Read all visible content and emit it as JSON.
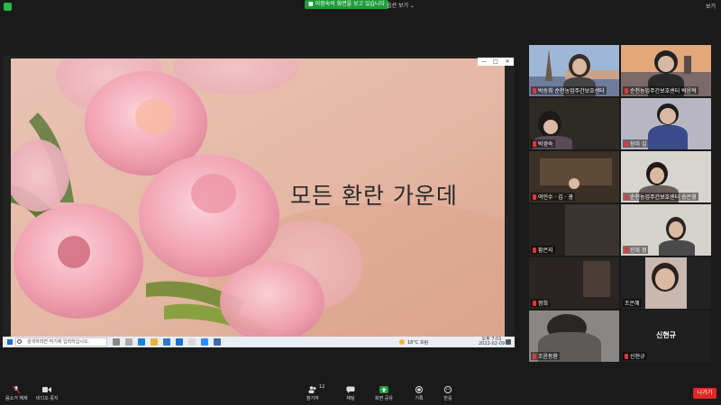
{
  "top_bar": {
    "share_banner": "■ 이정숙의 화면을 보고 있습니다",
    "view_options": "옵션 보기 ⌄",
    "view_label": "보기"
  },
  "shared_screen": {
    "slide_caption": "모든 환란 가운데",
    "window_controls": [
      "—",
      "□",
      "✕"
    ],
    "taskbar": {
      "search_placeholder": "검색하려면 여기에 입력하십시오.",
      "weather": "18°C 흐림",
      "time": "오후 7:01",
      "date": "2022-02-09"
    }
  },
  "gallery": {
    "tiles": [
      {
        "name": "박승희 순천농업주간보호센터",
        "muted": true
      },
      {
        "name": "순천농업주간보호센터 박윤혁",
        "muted": true
      },
      {
        "name": "박경숙",
        "muted": true
      },
      {
        "name": "장미 김",
        "muted": true
      },
      {
        "name": "여민수 · 김 · 광",
        "muted": true
      },
      {
        "name": "순천농업주간보호센터 송은영",
        "muted": true
      },
      {
        "name": "황은지",
        "muted": true
      },
      {
        "name": "진희 정",
        "muted": true
      },
      {
        "name": "정희",
        "muted": true
      },
      {
        "name": "조은혜",
        "muted": false
      },
      {
        "name": "조윤동환",
        "muted": true
      },
      {
        "name": "신현규",
        "muted": true,
        "display_name": "신현규"
      }
    ]
  },
  "toolbar": {
    "mute": "음소거 해제",
    "video": "비디오 중지",
    "participants": "참가자",
    "participants_count": "12",
    "chat": "채팅",
    "share": "화면 공유",
    "record": "기록",
    "reactions": "반응",
    "leave": "나가기"
  },
  "colors": {
    "share_green": "#1e9c3a",
    "active_speaker": "#d6e02c",
    "leave_red": "#e02828",
    "background": "#1a1a1a"
  }
}
